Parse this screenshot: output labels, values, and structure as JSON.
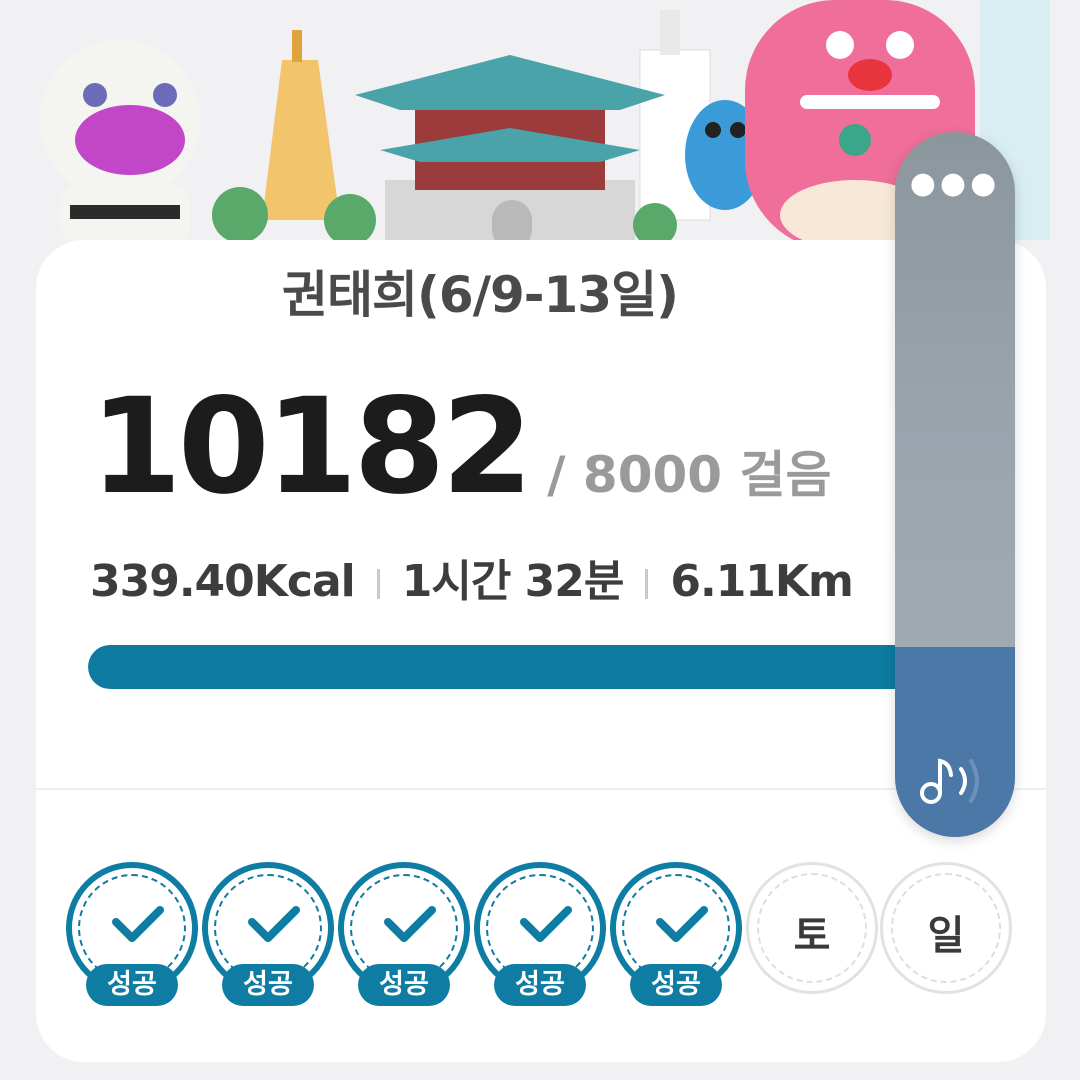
{
  "banner": {
    "illustration": "seoul-landmarks-with-mascots"
  },
  "title": "권태희(6/9-13일)",
  "steps": {
    "current": "10182",
    "goal_text": "/ 8000 걸음",
    "progress": 1.0
  },
  "stats": {
    "calories": "339.40Kcal",
    "duration": "1시간 32분",
    "distance": "6.11Km"
  },
  "days": [
    {
      "status": "success",
      "badge": "성공"
    },
    {
      "status": "success",
      "badge": "성공"
    },
    {
      "status": "success",
      "badge": "성공"
    },
    {
      "status": "success",
      "badge": "성공"
    },
    {
      "status": "success",
      "badge": "성공"
    },
    {
      "status": "pending",
      "label": "토"
    },
    {
      "status": "pending",
      "label": "일"
    }
  ],
  "volume_overlay": {
    "menu_icon": "more-dots-icon",
    "media_icon": "music-note-icon",
    "level": 0.27
  },
  "colors": {
    "primary": "#0f7ca3",
    "volume_fill": "#4c78a8"
  }
}
